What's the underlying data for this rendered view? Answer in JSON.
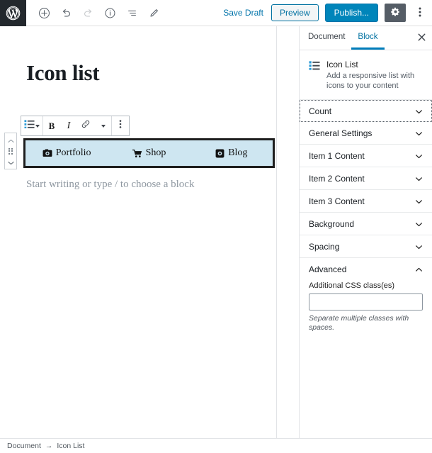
{
  "topbar": {
    "logo_icon": "wordpress-logo-icon",
    "tools": [
      {
        "name": "add-block-button",
        "icon": "plus-circle-icon",
        "disabled": false
      },
      {
        "name": "undo-button",
        "icon": "undo-arrow-icon",
        "disabled": false
      },
      {
        "name": "redo-button",
        "icon": "redo-arrow-icon",
        "disabled": true
      },
      {
        "name": "content-info-button",
        "icon": "info-circle-icon",
        "disabled": false
      },
      {
        "name": "block-navigation-button",
        "icon": "list-view-icon",
        "disabled": false
      },
      {
        "name": "edit-mode-button",
        "icon": "pencil-icon",
        "disabled": false
      }
    ],
    "save_draft_label": "Save Draft",
    "preview_label": "Preview",
    "publish_label": "Publish...",
    "settings_icon": "gear-icon",
    "more_menu_icon": "kebab-menu-icon"
  },
  "editor": {
    "post_title": "Icon list",
    "paragraph_placeholder": "Start writing or type / to choose a block",
    "block_toolbar": {
      "block_type_icon": "icon-list-icon",
      "block_type_caret_icon": "chevron-down-icon",
      "bold_label": "B",
      "italic_label": "I",
      "link_icon": "link-icon",
      "more_formats_caret_icon": "chevron-down-icon",
      "block_options_icon": "kebab-menu-icon"
    },
    "mover": {
      "up_icon": "chevron-up-icon",
      "drag_icon": "drag-handle-icon",
      "down_icon": "chevron-down-icon"
    },
    "icon_list_block": {
      "selected": true,
      "items": [
        {
          "icon": "camera-icon",
          "label": "Portfolio"
        },
        {
          "icon": "shopping-cart-icon",
          "label": "Shop"
        },
        {
          "icon": "record-square-icon",
          "label": "Blog"
        }
      ]
    }
  },
  "sidebar": {
    "tabs": [
      {
        "label": "Document",
        "active": false
      },
      {
        "label": "Block",
        "active": true
      }
    ],
    "close_icon": "close-icon",
    "block_card": {
      "icon": "icon-list-icon",
      "title": "Icon List",
      "description": "Add a responsive list with icons to your content"
    },
    "panels": [
      {
        "title": "Count",
        "open": false,
        "focused": true
      },
      {
        "title": "General Settings",
        "open": false,
        "focused": false
      },
      {
        "title": "Item 1 Content",
        "open": false,
        "focused": false
      },
      {
        "title": "Item 2 Content",
        "open": false,
        "focused": false
      },
      {
        "title": "Item 3 Content",
        "open": false,
        "focused": false
      },
      {
        "title": "Background",
        "open": false,
        "focused": false
      },
      {
        "title": "Spacing",
        "open": false,
        "focused": false
      }
    ],
    "advanced_panel": {
      "title": "Advanced",
      "open": true,
      "css_label": "Additional CSS class(es)",
      "css_value": "",
      "css_placeholder": "",
      "css_help": "Separate multiple classes with spaces."
    }
  },
  "breadcrumb": {
    "root_label": "Document",
    "separator": "→",
    "current_label": "Icon List"
  },
  "colors": {
    "accent_blue": "#0085ba",
    "link_blue": "#0071a1",
    "tab_active": "#007cba",
    "block_selection_bg": "#cee6f1",
    "block_selection_border": "#1e1e1e",
    "admin_dark": "#23282d"
  }
}
